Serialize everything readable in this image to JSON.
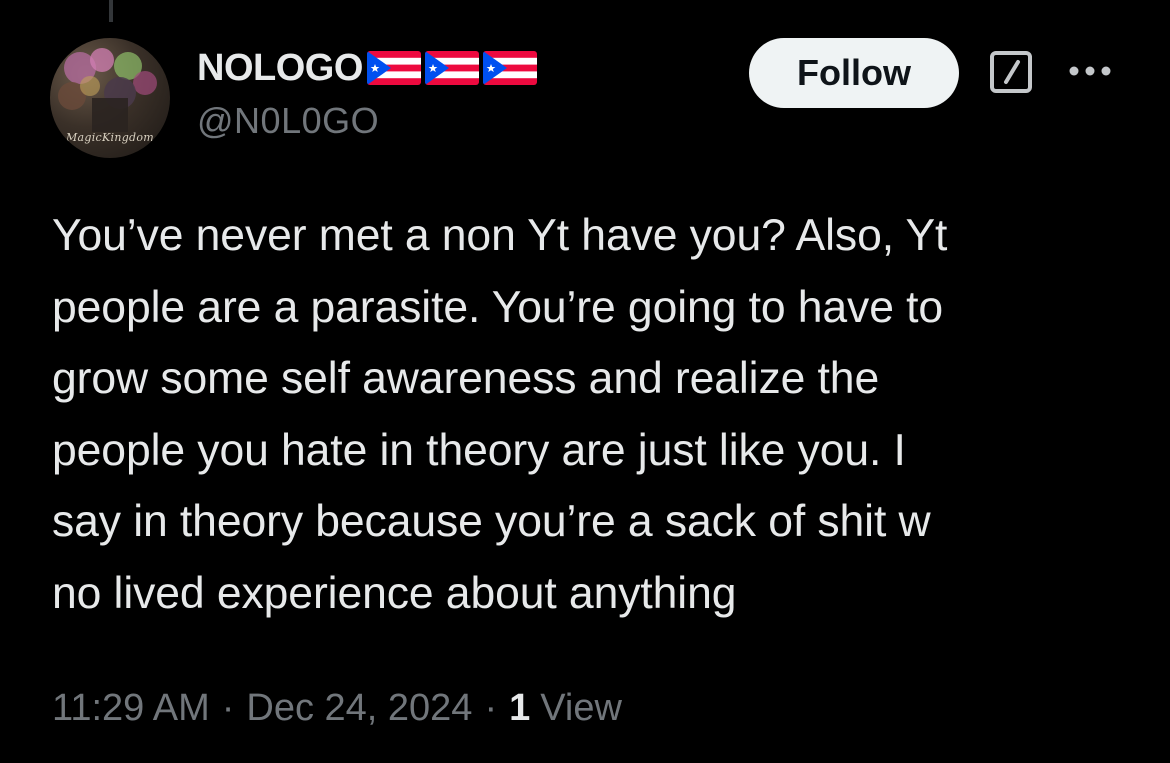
{
  "author": {
    "display_name": "NOLOGO",
    "flags": [
      "puerto-rico-flag",
      "puerto-rico-flag",
      "puerto-rico-flag"
    ],
    "handle": "@N0L0GO",
    "avatar_label": "MagicKingdom"
  },
  "actions": {
    "follow_label": "Follow",
    "grok_icon": "grok-icon",
    "more_icon": "more-icon"
  },
  "tweet": {
    "text": "You’ve never met a non Yt have you? Also, Yt\npeople are a parasite. You’re going to have to\ngrow some self awareness and realize the\npeople you hate in theory are just like you. I\nsay in theory because you’re a sack of shit w\nno lived experience about anything"
  },
  "meta": {
    "time": "11:29 AM",
    "separator": "·",
    "date": "Dec 24, 2024",
    "views_count": "1",
    "views_label": "View"
  },
  "colors": {
    "background": "#000000",
    "text_primary": "#e7e9ea",
    "text_secondary": "#71767b",
    "follow_bg": "#eff3f4",
    "flag_red": "#ed0a3f",
    "flag_blue": "#0050f0"
  }
}
